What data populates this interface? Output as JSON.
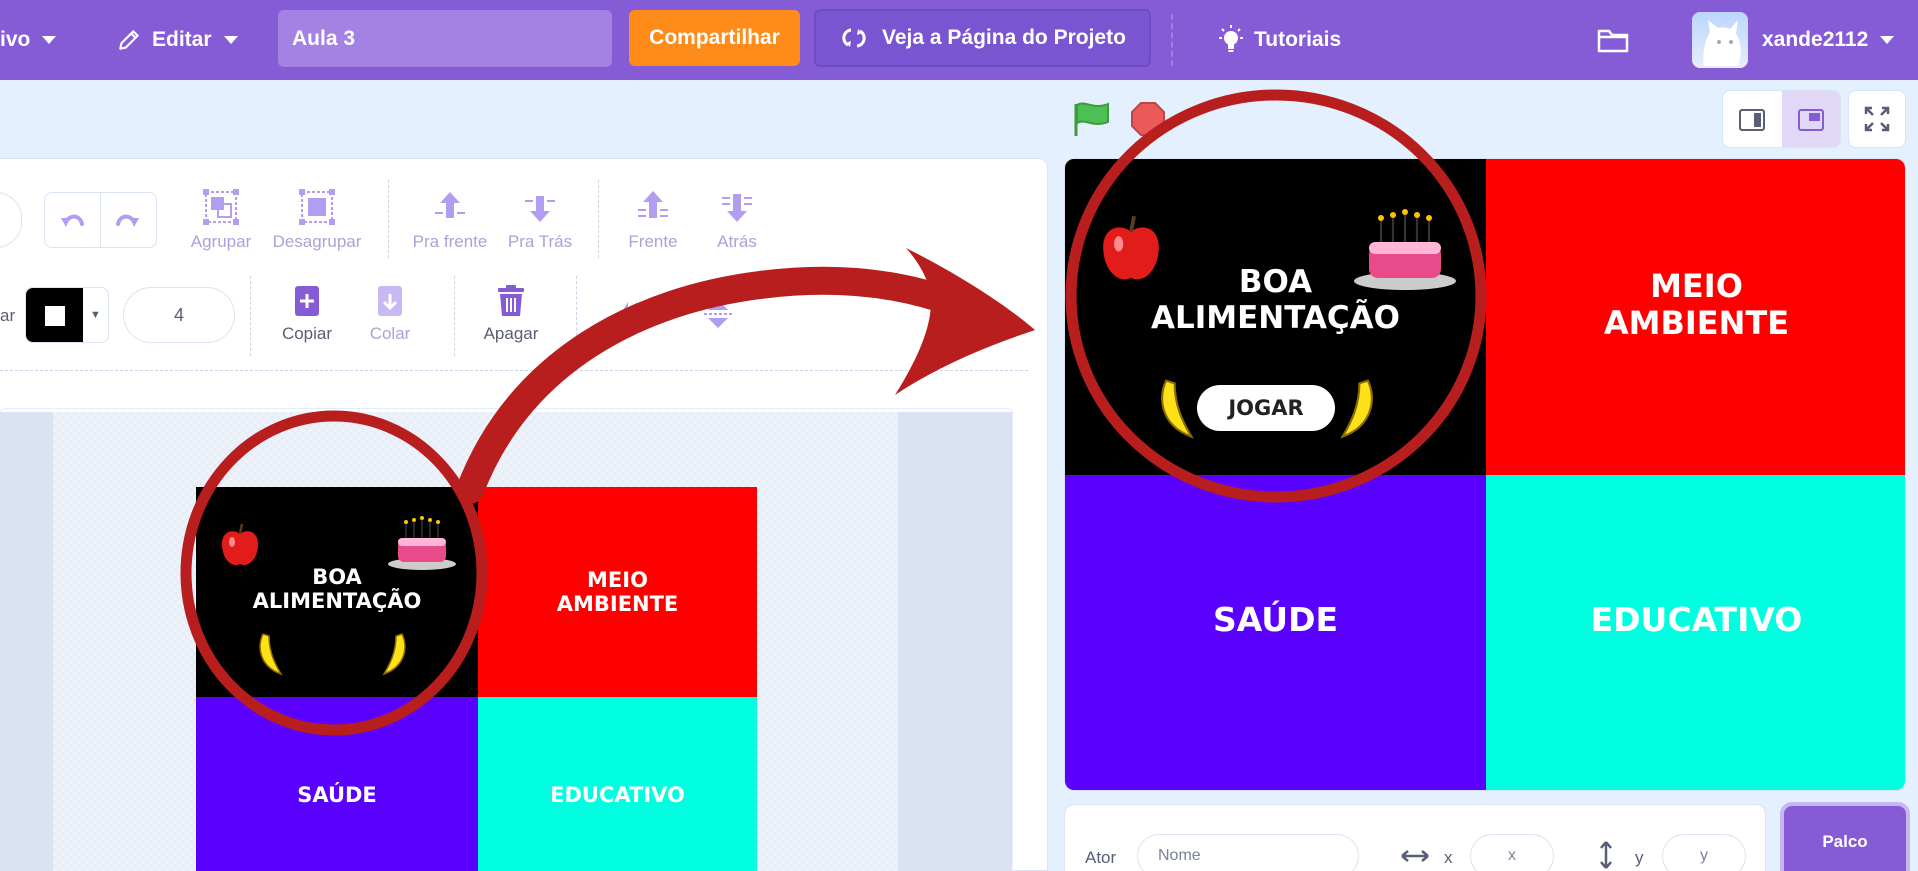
{
  "menu": {
    "file_label": "ivo",
    "edit_label": "Editar",
    "project_title": "Aula 3",
    "share_label": "Compartilhar",
    "project_page_label": "Veja a Página do Projeto",
    "tutorials_label": "Tutoriais",
    "username": "xande2112"
  },
  "paint": {
    "tools_row1": [
      {
        "label": "Agrupar"
      },
      {
        "label": "Desagrupar"
      },
      {
        "label": "Pra frente"
      },
      {
        "label": "Pra Trás"
      },
      {
        "label": "Frente"
      },
      {
        "label": "Atrás"
      }
    ],
    "outline_label": "ar",
    "outline_width": "4",
    "copy_label": "Copiar",
    "paste_label": "Colar",
    "delete_label": "Apagar"
  },
  "project_content": {
    "q1_line1": "BOA",
    "q1_line2": "ALIMENTAÇÃO",
    "q2_line1": "MEIO",
    "q2_line2": "AMBIENTE",
    "q3": "SAÚDE",
    "q4": "EDUCATIVO",
    "play_button": "JOGAR"
  },
  "sprite_info": {
    "sprite_label": "Ator",
    "name_placeholder": "Nome",
    "x_label": "x",
    "x_placeholder": "x",
    "y_label": "y",
    "y_placeholder": "y",
    "stage_tab": "Palco"
  },
  "colors": {
    "menu_bg": "#855cd6",
    "share": "#ff8c1a",
    "quad_black": "#000000",
    "quad_red": "#ff0000",
    "quad_purple": "#5a00ff",
    "quad_cyan": "#00ffe1",
    "annotation": "#b81e1e"
  },
  "icons": [
    "pencil-icon",
    "caret-down-icon",
    "remix-icon",
    "lightbulb-icon",
    "folder-icon",
    "green-flag-icon",
    "stop-icon",
    "small-stage-icon",
    "large-stage-icon",
    "fullscreen-icon",
    "undo-icon",
    "redo-icon",
    "group-icon",
    "ungroup-icon",
    "forward-icon",
    "backward-icon",
    "front-icon",
    "back-icon",
    "copy-icon",
    "paste-icon",
    "trash-icon",
    "apple-icon",
    "cake-icon",
    "banana-icon",
    "horizontal-arrows-icon",
    "vertical-arrows-icon"
  ]
}
